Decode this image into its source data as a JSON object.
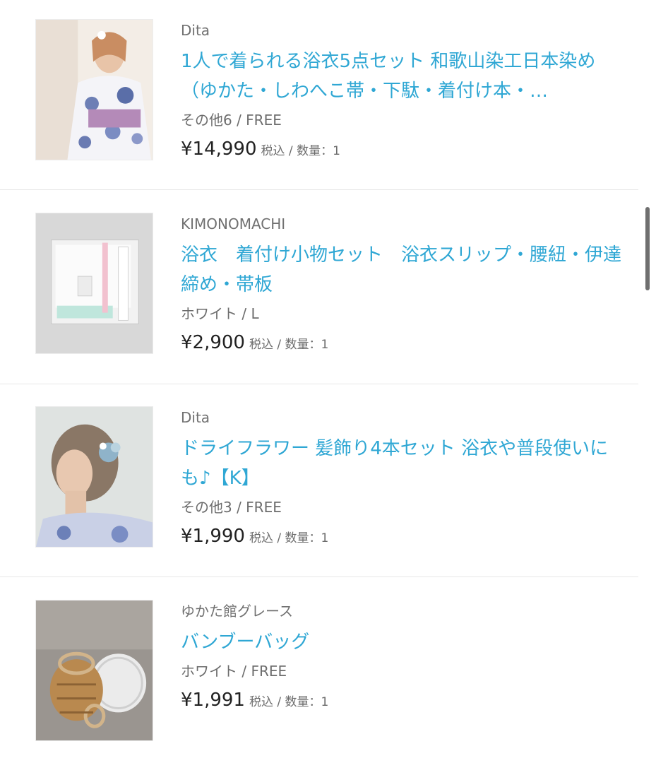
{
  "items": [
    {
      "brand": "Dita",
      "title": "1人で着られる浴衣5点セット 和歌山染工日本染め（ゆかた・しわへこ帯・下駄・着付け本・…",
      "variant": "その他6 / FREE",
      "price": "¥14,990",
      "tax": "税込 / 数量：1",
      "image": "woman-in-floral-yukata"
    },
    {
      "brand": "KIMONOMACHI",
      "title": "浴衣　着付け小物セット　浴衣スリップ・腰紐・伊達締め・帯板",
      "variant": "ホワイト / L",
      "price": "¥2,900",
      "tax": "税込 / 数量：1",
      "image": "packaged-accessory-set"
    },
    {
      "brand": "Dita",
      "title": "ドライフラワー 髪飾り4本セット 浴衣や普段使いにも♪【K】",
      "variant": "その他3 / FREE",
      "price": "¥1,990",
      "tax": "税込 / 数量：1",
      "image": "woman-hair-ornament-profile"
    },
    {
      "brand": "ゆかた館グレース",
      "title": "バンブーバッグ",
      "variant": "ホワイト / FREE",
      "price": "¥1,991",
      "tax": "税込 / 数量：1",
      "image": "woven-bags-on-stone"
    }
  ],
  "colors": {
    "link": "#2fa7d4",
    "text": "#222222",
    "muted": "#707070",
    "divider": "#e8e8e8"
  }
}
